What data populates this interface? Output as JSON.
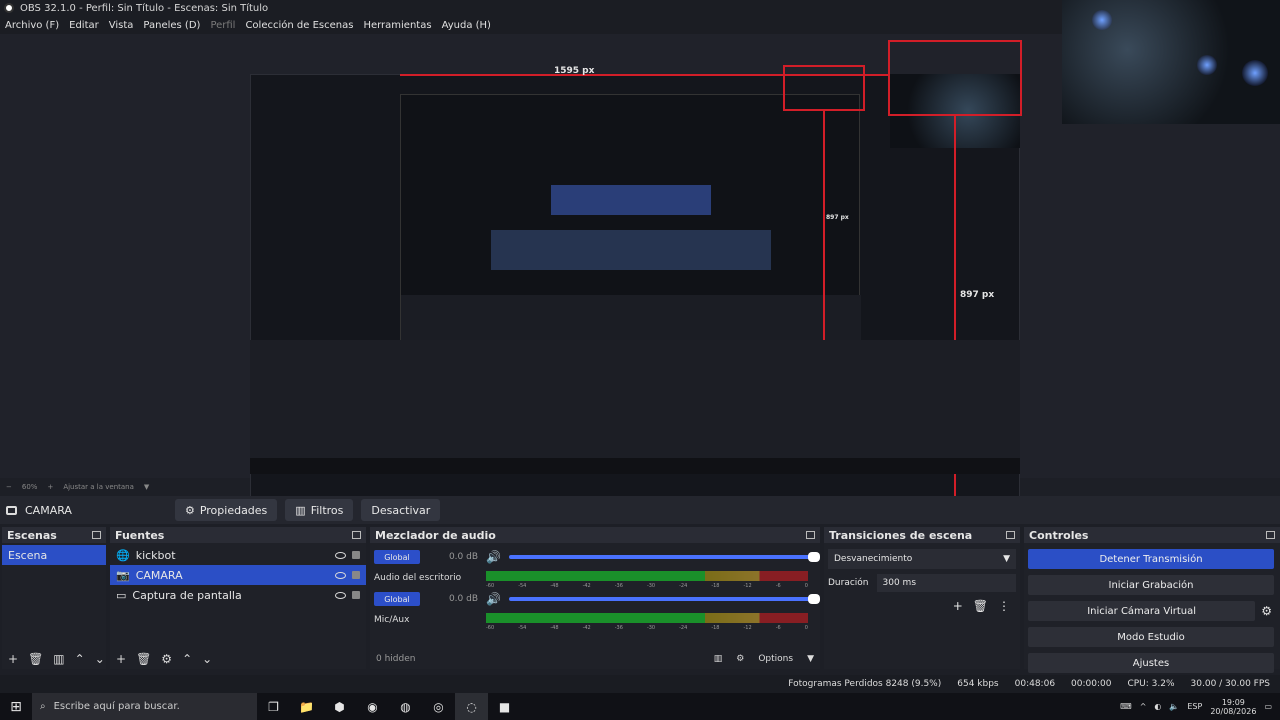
{
  "window": {
    "title": "OBS 32.1.0 - Perfil: Sin Título - Escenas: Sin Título"
  },
  "menu": [
    {
      "label": "Archivo (F)",
      "enabled": true
    },
    {
      "label": "Editar",
      "enabled": true
    },
    {
      "label": "Vista",
      "enabled": true
    },
    {
      "label": "Paneles (D)",
      "enabled": true
    },
    {
      "label": "Perfil",
      "enabled": false
    },
    {
      "label": "Colección de Escenas",
      "enabled": true
    },
    {
      "label": "Herramientas",
      "enabled": true
    },
    {
      "label": "Ayuda (H)",
      "enabled": true
    }
  ],
  "preview": {
    "label_width": "1595 px",
    "label_height_1": "897 px",
    "label_height_2": "897 px"
  },
  "zoom": {
    "value": "60%",
    "fit_label": "Ajustar a la ventana"
  },
  "source_toolbar": {
    "source_name": "CAMARA",
    "properties_label": "Propiedades",
    "filters_label": "Filtros",
    "deactivate_label": "Desactivar"
  },
  "scenes": {
    "title": "Escenas",
    "items": [
      "Escena"
    ]
  },
  "sources": {
    "title": "Fuentes",
    "items": [
      {
        "name": "kickbot",
        "icon": "globe-icon"
      },
      {
        "name": "CAMARA",
        "icon": "camera-icon"
      },
      {
        "name": "Captura de pantalla",
        "icon": "monitor-icon"
      }
    ]
  },
  "mixer": {
    "title": "Mezclador de audio",
    "tracks": [
      {
        "global_label": "Global",
        "db": "0.0 dB",
        "name": "Audio del escritorio"
      },
      {
        "global_label": "Global",
        "db": "0.0 dB",
        "name": "Mic/Aux"
      }
    ],
    "scale": [
      "-60",
      "-54",
      "-48",
      "-42",
      "-36",
      "-30",
      "-24",
      "-18",
      "-12",
      "-6",
      "0"
    ],
    "hidden_label": "0 hidden",
    "options_label": "Options"
  },
  "transitions": {
    "title": "Transiciones de escena",
    "selected": "Desvanecimiento",
    "duration_label": "Duración",
    "duration_value": "300 ms"
  },
  "controls": {
    "title": "Controles",
    "buttons": [
      "Detener Transmisión",
      "Iniciar Grabación",
      "Iniciar Cámara Virtual",
      "Modo Estudio",
      "Ajustes"
    ]
  },
  "status": {
    "dropped_frames": "Fotogramas Perdidos 8248 (9.5%)",
    "bitrate": "654 kbps",
    "stream_time": "00:48:06",
    "rec_time": "00:00:00",
    "cpu": "CPU: 3.2%",
    "fps": "30.00 / 30.00 FPS"
  },
  "taskbar": {
    "search_placeholder": "Escribe aquí para buscar.",
    "language": "ESP",
    "time": "19:09",
    "date": "20/08/2026"
  }
}
